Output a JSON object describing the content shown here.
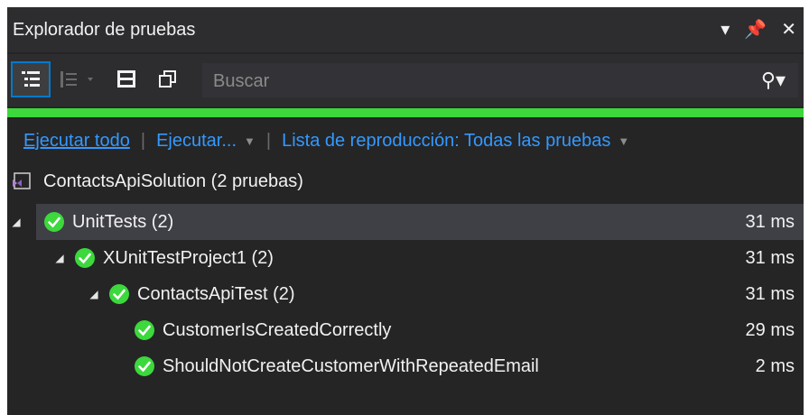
{
  "window": {
    "title": "Explorador de pruebas",
    "controls": [
      "dropdown-caret",
      "pin",
      "close"
    ]
  },
  "toolbar": {
    "search_placeholder": "Buscar"
  },
  "progress": {
    "fraction_passed": 1.0,
    "color": "#3cd83c"
  },
  "actions": {
    "run_all": "Ejecutar todo",
    "run": "Ejecutar...",
    "playlist": "Lista de reproducción: Todas las pruebas"
  },
  "solution": {
    "label": "ContactsApiSolution (2 pruebas)"
  },
  "tree": [
    {
      "label": "UnitTests (2)",
      "duration": "31 ms",
      "level": 0,
      "expanded": true,
      "selected": true
    },
    {
      "label": "XUnitTestProject1 (2)",
      "duration": "31 ms",
      "level": 1,
      "expanded": true
    },
    {
      "label": "ContactsApiTest (2)",
      "duration": "31 ms",
      "level": 2,
      "expanded": true
    },
    {
      "label": "CustomerIsCreatedCorrectly",
      "duration": "29 ms",
      "level": 3
    },
    {
      "label": "ShouldNotCreateCustomerWithRepeatedEmail",
      "duration": "2 ms",
      "level": 3
    }
  ],
  "colors": {
    "background": "#252526",
    "link": "#3399ff",
    "success": "#3cd83c",
    "selection": "#3f3f46"
  }
}
